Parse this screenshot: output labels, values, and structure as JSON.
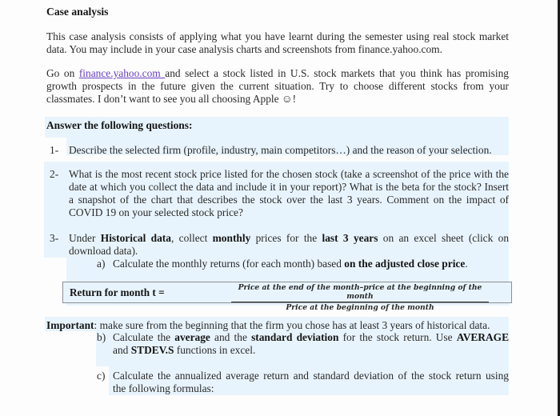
{
  "document": {
    "title": "Case analysis",
    "intro": {
      "line1": "This case analysis consists of applying what you have learnt during the semester using real stock market",
      "line2": "data. You may include in your case analysis charts and screenshots from finance.yahoo.com."
    },
    "instructions": {
      "prefix": "Go on ",
      "link_text": "finance.yahoo.com ",
      "line1_rest": "and select a stock listed in U.S. stock markets that you think has promising",
      "line2": "growth prospects in the future given the current situation. Try to choose different stocks from your",
      "line3": "classmates. I don’t want to see you all choosing Apple ☺!",
      "link_color": "#6a3fc0"
    },
    "questions_heading": "Answer the following questions:",
    "questions": [
      {
        "number": "1-",
        "lines": [
          "Describe the selected firm (profile, industry, main competitors…) and the reason of your selection."
        ]
      },
      {
        "number": "2-",
        "lines": [
          "What is the most recent stock price listed for the chosen stock (take a screenshot of the price with the",
          "date at which you collect the data and include it in your report)? What is the beta for the stock? Insert",
          "a snapshot of the chart that describes the stock over the last 3 years. Comment on the impact of",
          "COVID 19 on your selected stock price?"
        ]
      },
      {
        "number": "3-",
        "parts": {
          "t1": "Under ",
          "b1": "Historical data",
          "t2": ", collect ",
          "b2": "monthly",
          "t3": " prices for the ",
          "b3": "last 3 years",
          "t4": " on an excel sheet (click on",
          "line2": "download data)."
        },
        "subitems": [
          {
            "label": "a)",
            "text": "Calculate the monthly returns (for each month) based ",
            "bold": "on the adjusted close price",
            "tail": "."
          },
          {
            "label": "b)",
            "t1": "Calculate the ",
            "b1": "average",
            "t2": " and the ",
            "b2": "standard deviation",
            "t3": " for the stock return. Use ",
            "b3": "AVERAGE",
            "line2_t1": "and ",
            "line2_b1": "STDEV.S",
            "line2_t2": " functions in excel."
          },
          {
            "label": "c)",
            "line1": "Calculate the annualized average return and standard deviation of the stock return using",
            "line2": "the following formulas:"
          }
        ]
      }
    ],
    "formula": {
      "label": "Return for month t =",
      "numerator": "Price at the end of the month–price at the beginning of the month",
      "denominator": "Price at the beginning of the month"
    },
    "important": {
      "label": "Important",
      "text": ": make sure from the beginning that the firm you chose has at least 3 years of historical data."
    },
    "highlight_color": "#e8f4fd"
  }
}
